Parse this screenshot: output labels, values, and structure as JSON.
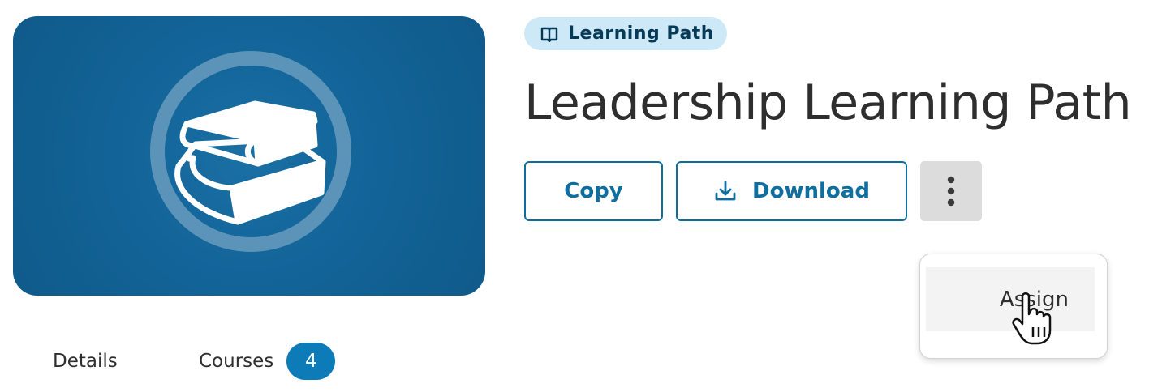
{
  "header": {
    "type_badge": "Learning Path",
    "title": "Leadership Learning Path"
  },
  "actions": {
    "copy_label": "Copy",
    "download_label": "Download",
    "more_menu": {
      "items": [
        {
          "label": "Assign"
        }
      ]
    }
  },
  "tabs": [
    {
      "label": "Details"
    },
    {
      "label": "Courses",
      "count": "4"
    }
  ],
  "icons": {
    "type_badge": "book-open-icon",
    "download": "download-icon",
    "more": "vertical-ellipsis-icon",
    "hero": "books-stack-icon",
    "cursor": "pointer-hand-cursor"
  },
  "colors": {
    "brand": "#0d6e9f",
    "badge_bg": "#cde9f8",
    "hero_bg": "#13659a",
    "count_badge": "#0d7bb8"
  }
}
